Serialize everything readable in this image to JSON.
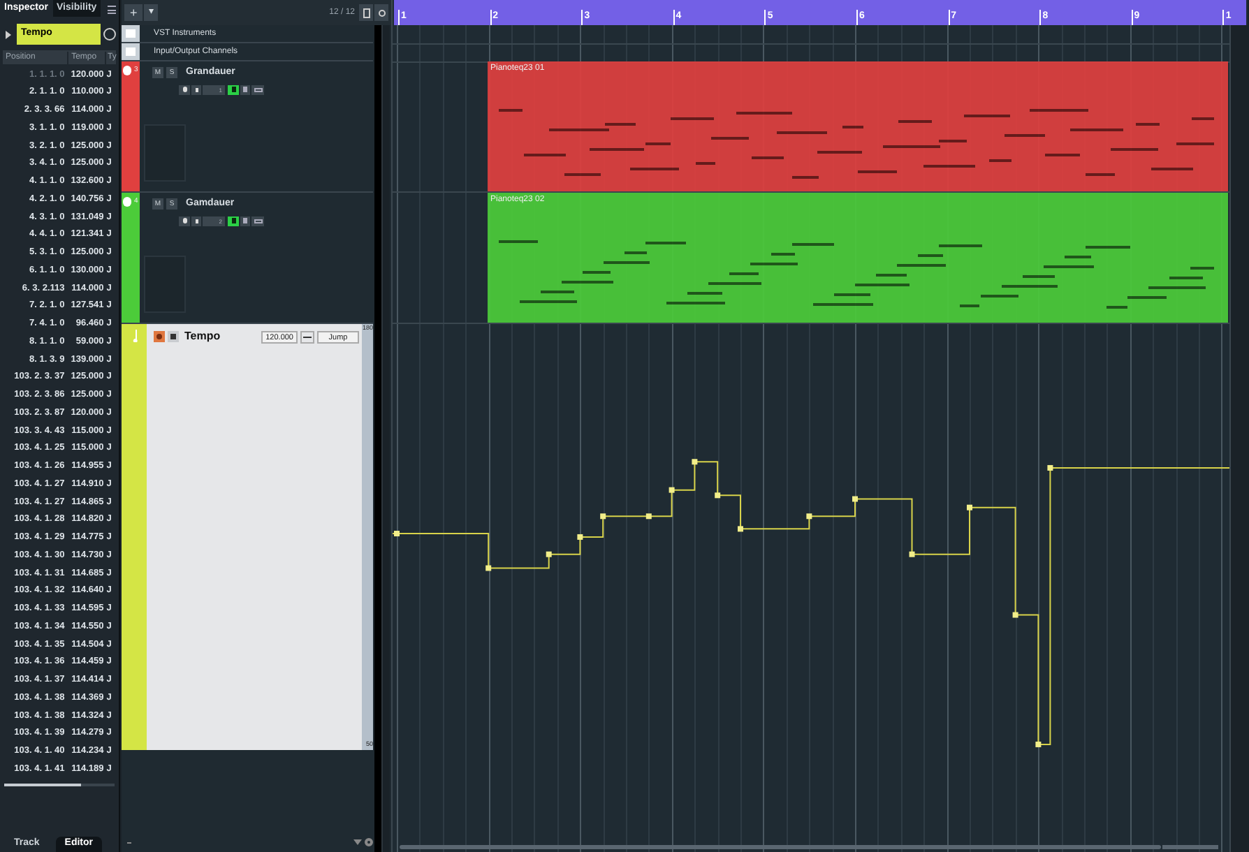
{
  "inspector": {
    "tabs": [
      {
        "label": "Inspector",
        "selected": true
      },
      {
        "label": "Visibility",
        "selected": false
      }
    ],
    "track_selector": {
      "value": "Tempo"
    },
    "columns": [
      "Position",
      "Tempo",
      "Ty"
    ],
    "rows": [
      {
        "position": "1. 1. 1. 0",
        "tempo": "120.000",
        "type": "J",
        "dimmed": true
      },
      {
        "position": "2. 1. 1. 0",
        "tempo": "110.000",
        "type": "J",
        "dimmed": false
      },
      {
        "position": "2. 3. 3. 66",
        "tempo": "114.000",
        "type": "J",
        "dimmed": false
      },
      {
        "position": "3. 1. 1. 0",
        "tempo": "119.000",
        "type": "J",
        "dimmed": false
      },
      {
        "position": "3. 2. 1. 0",
        "tempo": "125.000",
        "type": "J",
        "dimmed": false
      },
      {
        "position": "3. 4. 1. 0",
        "tempo": "125.000",
        "type": "J",
        "dimmed": false
      },
      {
        "position": "4. 1. 1. 0",
        "tempo": "132.600",
        "type": "J",
        "dimmed": false
      },
      {
        "position": "4. 2. 1. 0",
        "tempo": "140.756",
        "type": "J",
        "dimmed": false
      },
      {
        "position": "4. 3. 1. 0",
        "tempo": "131.049",
        "type": "J",
        "dimmed": false
      },
      {
        "position": "4. 4. 1. 0",
        "tempo": "121.341",
        "type": "J",
        "dimmed": false
      },
      {
        "position": "5. 3. 1. 0",
        "tempo": "125.000",
        "type": "J",
        "dimmed": false
      },
      {
        "position": "6. 1. 1. 0",
        "tempo": "130.000",
        "type": "J",
        "dimmed": false
      },
      {
        "position": "6. 3. 2.113",
        "tempo": "114.000",
        "type": "J",
        "dimmed": false
      },
      {
        "position": "7. 2. 1. 0",
        "tempo": "127.541",
        "type": "J",
        "dimmed": false
      },
      {
        "position": "7. 4. 1. 0",
        "tempo": "96.460",
        "type": "J",
        "dimmed": false
      },
      {
        "position": "8. 1. 1. 0",
        "tempo": "59.000",
        "type": "J",
        "dimmed": false
      },
      {
        "position": "8. 1. 3. 9",
        "tempo": "139.000",
        "type": "J",
        "dimmed": false
      },
      {
        "position": "103. 2. 3. 37",
        "tempo": "125.000",
        "type": "J",
        "dimmed": false
      },
      {
        "position": "103. 2. 3. 86",
        "tempo": "125.000",
        "type": "J",
        "dimmed": false
      },
      {
        "position": "103. 2. 3. 87",
        "tempo": "120.000",
        "type": "J",
        "dimmed": false
      },
      {
        "position": "103. 3. 4. 43",
        "tempo": "115.000",
        "type": "J",
        "dimmed": false
      },
      {
        "position": "103. 4. 1. 25",
        "tempo": "115.000",
        "type": "J",
        "dimmed": false
      },
      {
        "position": "103. 4. 1. 26",
        "tempo": "114.955",
        "type": "J",
        "dimmed": false
      },
      {
        "position": "103. 4. 1. 27",
        "tempo": "114.910",
        "type": "J",
        "dimmed": false
      },
      {
        "position": "103. 4. 1. 27",
        "tempo": "114.865",
        "type": "J",
        "dimmed": false
      },
      {
        "position": "103. 4. 1. 28",
        "tempo": "114.820",
        "type": "J",
        "dimmed": false
      },
      {
        "position": "103. 4. 1. 29",
        "tempo": "114.775",
        "type": "J",
        "dimmed": false
      },
      {
        "position": "103. 4. 1. 30",
        "tempo": "114.730",
        "type": "J",
        "dimmed": false
      },
      {
        "position": "103. 4. 1. 31",
        "tempo": "114.685",
        "type": "J",
        "dimmed": false
      },
      {
        "position": "103. 4. 1. 32",
        "tempo": "114.640",
        "type": "J",
        "dimmed": false
      },
      {
        "position": "103. 4. 1. 33",
        "tempo": "114.595",
        "type": "J",
        "dimmed": false
      },
      {
        "position": "103. 4. 1. 34",
        "tempo": "114.550",
        "type": "J",
        "dimmed": false
      },
      {
        "position": "103. 4. 1. 35",
        "tempo": "114.504",
        "type": "J",
        "dimmed": false
      },
      {
        "position": "103. 4. 1. 36",
        "tempo": "114.459",
        "type": "J",
        "dimmed": false
      },
      {
        "position": "103. 4. 1. 37",
        "tempo": "114.414",
        "type": "J",
        "dimmed": false
      },
      {
        "position": "103. 4. 1. 38",
        "tempo": "114.369",
        "type": "J",
        "dimmed": false
      },
      {
        "position": "103. 4. 1. 38",
        "tempo": "114.324",
        "type": "J",
        "dimmed": false
      },
      {
        "position": "103. 4. 1. 39",
        "tempo": "114.279",
        "type": "J",
        "dimmed": false
      },
      {
        "position": "103. 4. 1. 40",
        "tempo": "114.234",
        "type": "J",
        "dimmed": false
      },
      {
        "position": "103. 4. 1. 41",
        "tempo": "114.189",
        "type": "J",
        "dimmed": false
      }
    ],
    "bottom_tabs": [
      {
        "label": "Track",
        "selected": false
      },
      {
        "label": "Editor",
        "selected": true
      }
    ]
  },
  "track_list": {
    "toolbar": {
      "add": "+",
      "menu": "▾",
      "count": "12 / 12"
    },
    "folders": [
      {
        "name": "VST Instruments"
      },
      {
        "name": "Input/Output Channels"
      }
    ],
    "tracks": [
      {
        "number": "3",
        "name": "Grandauer",
        "color": "#e0403f",
        "mute": "M",
        "solo": "S",
        "channel": "1",
        "read": true,
        "part": {
          "name": "Pianoteq23 01"
        }
      },
      {
        "number": "4",
        "name": "Gamdauer",
        "color": "#4ccc3a",
        "mute": "M",
        "solo": "S",
        "channel": "2",
        "read": true,
        "part": {
          "name": "Pianoteq23 02"
        }
      }
    ],
    "tempo_track": {
      "name": "Tempo",
      "color": "#d4e545",
      "tempo": "120.000",
      "mode": "Jump",
      "range_max": "180",
      "range_min": "50"
    }
  },
  "ruler": {
    "labels": [
      "1",
      "2",
      "3",
      "4",
      "5",
      "6",
      "7",
      "8",
      "9",
      "1"
    ]
  }
}
